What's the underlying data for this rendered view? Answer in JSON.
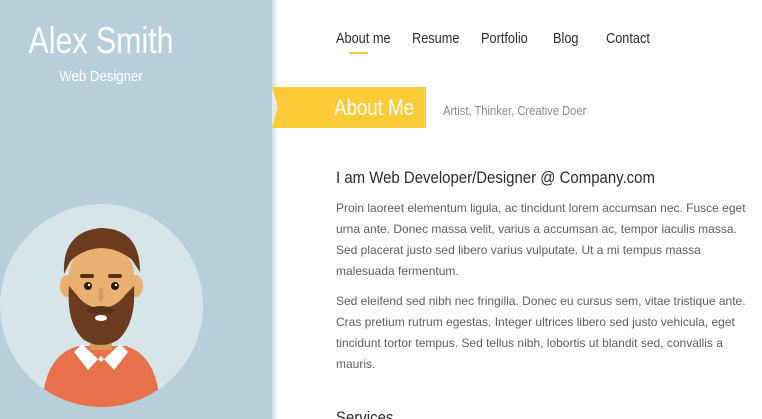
{
  "profile": {
    "name": "Alex Smith",
    "title": "Web Designer"
  },
  "nav": {
    "items": [
      {
        "label": "About me",
        "active": true
      },
      {
        "label": "Resume",
        "active": false
      },
      {
        "label": "Portfolio",
        "active": false
      },
      {
        "label": "Blog",
        "active": false
      },
      {
        "label": "Contact",
        "active": false
      }
    ]
  },
  "section": {
    "title": "About Me",
    "tagline": "Artist, Thinker, Creative Doer"
  },
  "content": {
    "heading": "I am Web Developer/Designer @ Company.com",
    "paragraphs": [
      "Proin laoreet elementum ligula, ac tincidunt lorem accumsan nec. Fusce eget urna ante. Donec massa velit, varius a accumsan ac, tempor iaculis massa. Sed placerat justo sed libero varius vulputate. Ut a mi tempus massa malesuada fermentum.",
      "Sed eleifend sed nibh nec fringilla. Donec eu cursus sem, vitae tristique ante. Cras pretium rutrum egestas. Integer ultrices libero sed justo vehicula, eget tincidunt tortor tempus. Sed tellus nibh, lobortis ut blandit sed, convallis a mauris."
    ],
    "next_heading": "Services"
  },
  "colors": {
    "sidebar_bg": "#b6cfdb",
    "accent": "#fccb38",
    "avatar_circle": "#d6e5e8",
    "shirt": "#e8704a",
    "hair": "#6b3a1f",
    "skin": "#e9b071"
  },
  "icons": {
    "avatar": "bearded-man-avatar"
  }
}
